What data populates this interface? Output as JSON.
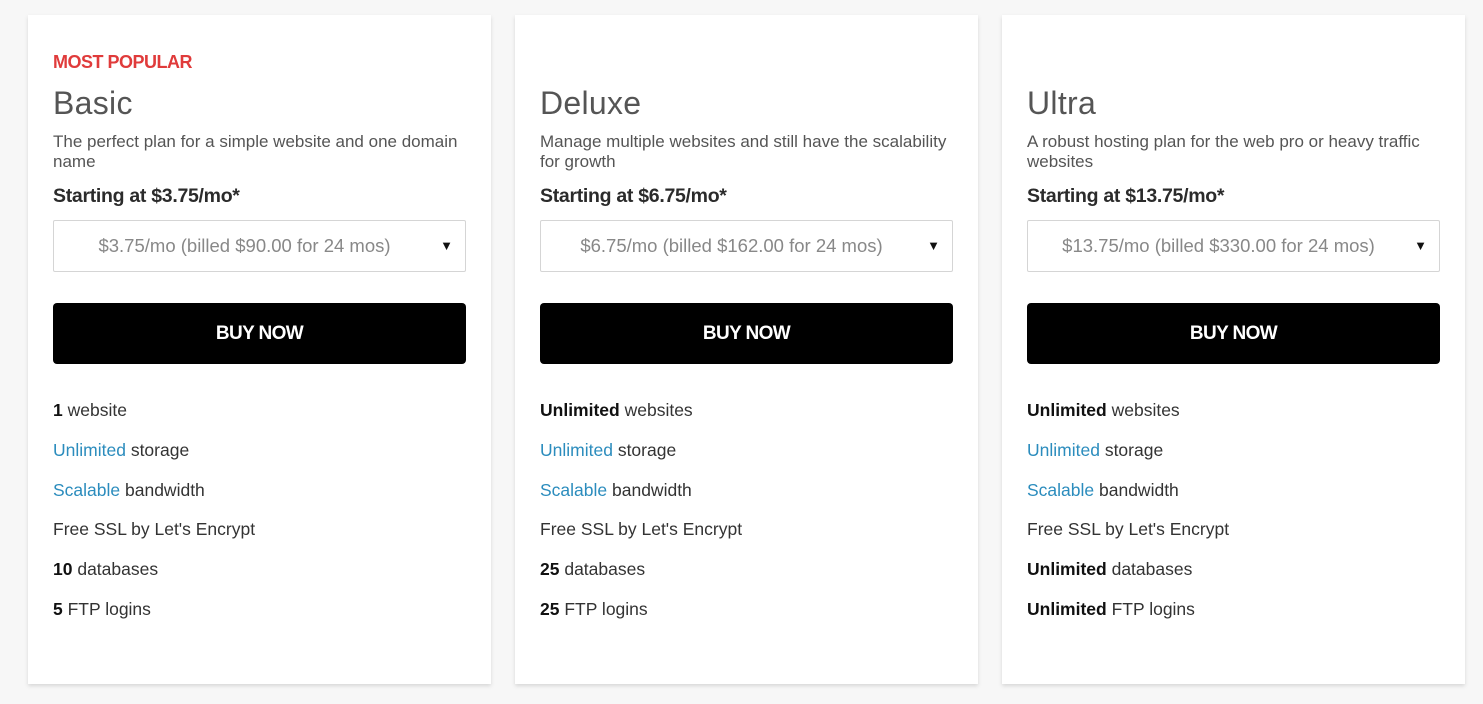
{
  "colors": {
    "badge": "#e03b3b",
    "link": "#2b8cbd",
    "button_bg": "#000000",
    "card_bg": "#ffffff",
    "page_bg": "#f7f7f7"
  },
  "icons": {
    "select_caret": "triangle-down"
  },
  "plans": [
    {
      "badge": "MOST POPULAR",
      "name": "Basic",
      "description": "The perfect plan for a simple website and one domain name",
      "starting_price": "Starting at $3.75/mo*",
      "term_selected": "$3.75/mo (billed $90.00 for 24 mos)",
      "buy_label": "BUY NOW",
      "features": [
        {
          "lead": "1",
          "rest": " website"
        },
        {
          "lead": "Unlimited",
          "rest": " storage"
        },
        {
          "lead": "Scalable",
          "rest": " bandwidth"
        },
        {
          "lead": "",
          "rest": "Free SSL by Let's Encrypt"
        },
        {
          "lead": "10",
          "rest": " databases"
        },
        {
          "lead": "5",
          "rest": " FTP logins"
        }
      ]
    },
    {
      "badge": "",
      "name": "Deluxe",
      "description": "Manage multiple websites and still have the scalability for growth",
      "starting_price": "Starting at $6.75/mo*",
      "term_selected": "$6.75/mo (billed $162.00 for 24 mos)",
      "buy_label": "BUY NOW",
      "features": [
        {
          "lead": "Unlimited",
          "rest": " websites"
        },
        {
          "lead": "Unlimited",
          "rest": " storage"
        },
        {
          "lead": "Scalable",
          "rest": " bandwidth"
        },
        {
          "lead": "",
          "rest": "Free SSL by Let's Encrypt"
        },
        {
          "lead": "25",
          "rest": " databases"
        },
        {
          "lead": "25",
          "rest": " FTP logins"
        }
      ]
    },
    {
      "badge": "",
      "name": "Ultra",
      "description": "A robust hosting plan for the web pro or heavy traffic websites",
      "starting_price": "Starting at $13.75/mo*",
      "term_selected": "$13.75/mo (billed $330.00 for 24 mos)",
      "buy_label": "BUY NOW",
      "features": [
        {
          "lead": "Unlimited",
          "rest": " websites"
        },
        {
          "lead": "Unlimited",
          "rest": " storage"
        },
        {
          "lead": "Scalable",
          "rest": " bandwidth"
        },
        {
          "lead": "",
          "rest": "Free SSL by Let's Encrypt"
        },
        {
          "lead": "Unlimited",
          "rest": " databases"
        },
        {
          "lead": "Unlimited",
          "rest": " FTP logins"
        }
      ]
    }
  ]
}
